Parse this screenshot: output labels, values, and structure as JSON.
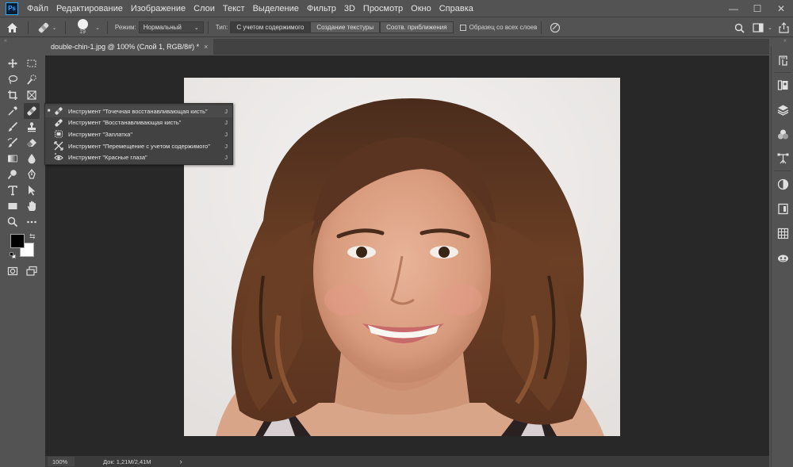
{
  "app": {
    "logo_text": "Ps"
  },
  "menu": [
    "Файл",
    "Редактирование",
    "Изображение",
    "Слои",
    "Текст",
    "Выделение",
    "Фильтр",
    "3D",
    "Просмотр",
    "Окно",
    "Справка"
  ],
  "window_controls": {
    "minimize": "—",
    "maximize": "☐",
    "close": "✕"
  },
  "options": {
    "brush_size": "19",
    "mode_label": "Режим:",
    "mode_value": "Нормальный",
    "type_label": "Тип:",
    "type_buttons": [
      "С учетом содержимого",
      "Создание текстуры",
      "Соотв. приближения"
    ],
    "sample_all_layers": "Образец со всех слоев"
  },
  "document": {
    "tab_title": "double-chin-1.jpg @ 100% (Слой 1, RGB/8#) *",
    "tab_close": "×"
  },
  "status": {
    "zoom": "100%",
    "doc_info": "Док: 1,21M/2,41M",
    "arrow": "›"
  },
  "collapse_glyph": "«",
  "flyout": {
    "items": [
      {
        "label": "Инструмент \"Точечная восстанавливающая кисть\"",
        "key": "J",
        "selected": true,
        "icon": "spot-healing-brush-icon"
      },
      {
        "label": "Инструмент \"Восстанавливающая кисть\"",
        "key": "J",
        "selected": false,
        "icon": "healing-brush-icon"
      },
      {
        "label": "Инструмент \"Заплатка\"",
        "key": "J",
        "selected": false,
        "icon": "patch-icon"
      },
      {
        "label": "Инструмент \"Перемещение с учетом содержимого\"",
        "key": "J",
        "selected": false,
        "icon": "content-aware-move-icon"
      },
      {
        "label": "Инструмент \"Красные глаза\"",
        "key": "J",
        "selected": false,
        "icon": "red-eye-icon"
      }
    ],
    "selected_mark": "■"
  },
  "colors": {
    "foreground": "#000000",
    "background": "#ffffff",
    "canvas_bg": "#282828",
    "ui_bg": "#535353"
  }
}
